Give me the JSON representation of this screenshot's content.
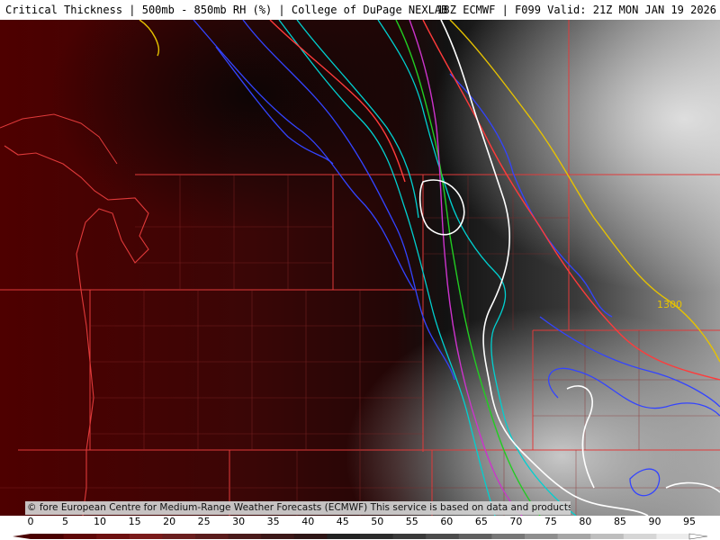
{
  "header": {
    "title": "Critical Thickness | 500mb - 850mb RH (%) | College of DuPage NEXLAB",
    "model_valid": "18Z ECMWF | F099 Valid: 21Z MON JAN 19 2026"
  },
  "map": {
    "contour_labels": [
      "1300"
    ]
  },
  "credit": "© fore European Centre for Medium-Range Weather Forecasts (ECMWF)  This service is based on data and products of the (ECMWF)",
  "legend": {
    "ticks": [
      "0",
      "5",
      "10",
      "15",
      "20",
      "25",
      "30",
      "35",
      "40",
      "45",
      "50",
      "55",
      "60",
      "65",
      "70",
      "75",
      "80",
      "85",
      "90",
      "95"
    ],
    "color_ramp": [
      "#4a0000",
      "#5e0808",
      "#6d1010",
      "#7a1a1a",
      "#6a1e1e",
      "#5a1c1c",
      "#4a1a1a",
      "#3c1818",
      "#2e1616",
      "#222222",
      "#2c2c2c",
      "#3a3a3a",
      "#4c4c4c",
      "#606060",
      "#777777",
      "#8e8e8e",
      "#a6a6a6",
      "#bebebe",
      "#d6d6d6",
      "#ececec"
    ]
  }
}
